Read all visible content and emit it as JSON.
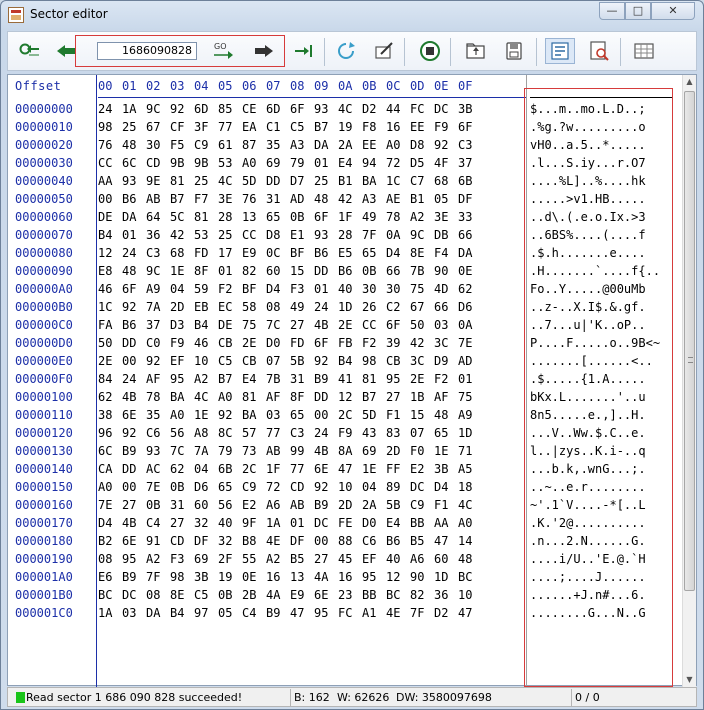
{
  "window": {
    "title": "Sector editor",
    "caption": {
      "minimize": "—",
      "maximize": "□",
      "close": "✕"
    }
  },
  "toolbar": {
    "sector_value": "1686090828",
    "go_label": "GO",
    "icons": [
      "first-sector-icon",
      "previous-sector-icon",
      "go-icon",
      "next-sector-icon",
      "last-sector-icon",
      "refresh-icon",
      "edit-icon",
      "stop-icon",
      "open-file-icon",
      "save-icon",
      "view-mode-icon",
      "search-icon",
      "settings-icon"
    ]
  },
  "editor": {
    "header_offset": "Offset",
    "columns": [
      "00",
      "01",
      "02",
      "03",
      "04",
      "05",
      "06",
      "07",
      "08",
      "09",
      "0A",
      "0B",
      "0C",
      "0D",
      "0E",
      "0F"
    ],
    "rows": [
      {
        "offset": "00000000",
        "bytes": [
          "24",
          "1A",
          "9C",
          "92",
          "6D",
          "85",
          "CE",
          "6D",
          "6F",
          "93",
          "4C",
          "D2",
          "44",
          "FC",
          "DC",
          "3B"
        ],
        "ascii": "$...m..mo.L.D..;"
      },
      {
        "offset": "00000010",
        "bytes": [
          "98",
          "25",
          "67",
          "CF",
          "3F",
          "77",
          "EA",
          "C1",
          "C5",
          "B7",
          "19",
          "F8",
          "16",
          "EE",
          "F9",
          "6F"
        ],
        "ascii": ".%g.?w.........o"
      },
      {
        "offset": "00000020",
        "bytes": [
          "76",
          "48",
          "30",
          "F5",
          "C9",
          "61",
          "87",
          "35",
          "A3",
          "DA",
          "2A",
          "EE",
          "A0",
          "D8",
          "92",
          "C3"
        ],
        "ascii": "vH0..a.5..*....."
      },
      {
        "offset": "00000030",
        "bytes": [
          "CC",
          "6C",
          "CD",
          "9B",
          "9B",
          "53",
          "A0",
          "69",
          "79",
          "01",
          "E4",
          "94",
          "72",
          "D5",
          "4F",
          "37"
        ],
        "ascii": ".l...S.iy...r.O7"
      },
      {
        "offset": "00000040",
        "bytes": [
          "AA",
          "93",
          "9E",
          "81",
          "25",
          "4C",
          "5D",
          "DD",
          "D7",
          "25",
          "B1",
          "BA",
          "1C",
          "C7",
          "68",
          "6B"
        ],
        "ascii": "....%L]..%....hk"
      },
      {
        "offset": "00000050",
        "bytes": [
          "00",
          "B6",
          "AB",
          "B7",
          "F7",
          "3E",
          "76",
          "31",
          "AD",
          "48",
          "42",
          "A3",
          "AE",
          "B1",
          "05",
          "DF"
        ],
        "ascii": ".....>v1.HB....."
      },
      {
        "offset": "00000060",
        "bytes": [
          "DE",
          "DA",
          "64",
          "5C",
          "81",
          "28",
          "13",
          "65",
          "0B",
          "6F",
          "1F",
          "49",
          "78",
          "A2",
          "3E",
          "33"
        ],
        "ascii": "..d\\.(.e.o.Ix.>3"
      },
      {
        "offset": "00000070",
        "bytes": [
          "B4",
          "01",
          "36",
          "42",
          "53",
          "25",
          "CC",
          "D8",
          "E1",
          "93",
          "28",
          "7F",
          "0A",
          "9C",
          "DB",
          "66"
        ],
        "ascii": "..6BS%....(....f"
      },
      {
        "offset": "00000080",
        "bytes": [
          "12",
          "24",
          "C3",
          "68",
          "FD",
          "17",
          "E9",
          "0C",
          "BF",
          "B6",
          "E5",
          "65",
          "D4",
          "8E",
          "F4",
          "DA"
        ],
        "ascii": ".$.h.......e...."
      },
      {
        "offset": "00000090",
        "bytes": [
          "E8",
          "48",
          "9C",
          "1E",
          "8F",
          "01",
          "82",
          "60",
          "15",
          "DD",
          "B6",
          "0B",
          "66",
          "7B",
          "90",
          "0E"
        ],
        "ascii": ".H.......`....f{.."
      },
      {
        "offset": "000000A0",
        "bytes": [
          "46",
          "6F",
          "A9",
          "04",
          "59",
          "F2",
          "BF",
          "D4",
          "F3",
          "01",
          "40",
          "30",
          "30",
          "75",
          "4D",
          "62"
        ],
        "ascii": "Fo..Y.....@00uMb"
      },
      {
        "offset": "000000B0",
        "bytes": [
          "1C",
          "92",
          "7A",
          "2D",
          "EB",
          "EC",
          "58",
          "08",
          "49",
          "24",
          "1D",
          "26",
          "C2",
          "67",
          "66",
          "D6"
        ],
        "ascii": "..z-..X.I$.&.gf."
      },
      {
        "offset": "000000C0",
        "bytes": [
          "FA",
          "B6",
          "37",
          "D3",
          "B4",
          "DE",
          "75",
          "7C",
          "27",
          "4B",
          "2E",
          "CC",
          "6F",
          "50",
          "03",
          "0A"
        ],
        "ascii": "..7...u|'K..oP.."
      },
      {
        "offset": "000000D0",
        "bytes": [
          "50",
          "DD",
          "C0",
          "F9",
          "46",
          "CB",
          "2E",
          "D0",
          "FD",
          "6F",
          "FB",
          "F2",
          "39",
          "42",
          "3C",
          "7E"
        ],
        "ascii": "P....F.....o..9B<~"
      },
      {
        "offset": "000000E0",
        "bytes": [
          "2E",
          "00",
          "92",
          "EF",
          "10",
          "C5",
          "CB",
          "07",
          "5B",
          "92",
          "B4",
          "98",
          "CB",
          "3C",
          "D9",
          "AD"
        ],
        "ascii": ".......[......<.."
      },
      {
        "offset": "000000F0",
        "bytes": [
          "84",
          "24",
          "AF",
          "95",
          "A2",
          "B7",
          "E4",
          "7B",
          "31",
          "B9",
          "41",
          "81",
          "95",
          "2E",
          "F2",
          "01"
        ],
        "ascii": ".$.....{1.A....."
      },
      {
        "offset": "00000100",
        "bytes": [
          "62",
          "4B",
          "78",
          "BA",
          "4C",
          "A0",
          "81",
          "AF",
          "8F",
          "DD",
          "12",
          "B7",
          "27",
          "1B",
          "AF",
          "75"
        ],
        "ascii": "bKx.L.......'..u"
      },
      {
        "offset": "00000110",
        "bytes": [
          "38",
          "6E",
          "35",
          "A0",
          "1E",
          "92",
          "BA",
          "03",
          "65",
          "00",
          "2C",
          "5D",
          "F1",
          "15",
          "48",
          "A9"
        ],
        "ascii": "8n5.....e.,]..H."
      },
      {
        "offset": "00000120",
        "bytes": [
          "96",
          "92",
          "C6",
          "56",
          "A8",
          "8C",
          "57",
          "77",
          "C3",
          "24",
          "F9",
          "43",
          "83",
          "07",
          "65",
          "1D"
        ],
        "ascii": "...V..Ww.$.C..e."
      },
      {
        "offset": "00000130",
        "bytes": [
          "6C",
          "B9",
          "93",
          "7C",
          "7A",
          "79",
          "73",
          "AB",
          "99",
          "4B",
          "8A",
          "69",
          "2D",
          "F0",
          "1E",
          "71"
        ],
        "ascii": "l..|zys..K.i-..q"
      },
      {
        "offset": "00000140",
        "bytes": [
          "CA",
          "DD",
          "AC",
          "62",
          "04",
          "6B",
          "2C",
          "1F",
          "77",
          "6E",
          "47",
          "1E",
          "FF",
          "E2",
          "3B",
          "A5"
        ],
        "ascii": "...b.k,.wnG...;."
      },
      {
        "offset": "00000150",
        "bytes": [
          "A0",
          "00",
          "7E",
          "0B",
          "D6",
          "65",
          "C9",
          "72",
          "CD",
          "92",
          "10",
          "04",
          "89",
          "DC",
          "D4",
          "18"
        ],
        "ascii": "..~..e.r........"
      },
      {
        "offset": "00000160",
        "bytes": [
          "7E",
          "27",
          "0B",
          "31",
          "60",
          "56",
          "E2",
          "A6",
          "AB",
          "B9",
          "2D",
          "2A",
          "5B",
          "C9",
          "F1",
          "4C"
        ],
        "ascii": "~'.1`V....-*[..L"
      },
      {
        "offset": "00000170",
        "bytes": [
          "D4",
          "4B",
          "C4",
          "27",
          "32",
          "40",
          "9F",
          "1A",
          "01",
          "DC",
          "FE",
          "D0",
          "E4",
          "BB",
          "AA",
          "A0"
        ],
        "ascii": ".K.'2@.........."
      },
      {
        "offset": "00000180",
        "bytes": [
          "B2",
          "6E",
          "91",
          "CD",
          "DF",
          "32",
          "B8",
          "4E",
          "DF",
          "00",
          "88",
          "C6",
          "B6",
          "B5",
          "47",
          "14"
        ],
        "ascii": ".n...2.N......G."
      },
      {
        "offset": "00000190",
        "bytes": [
          "08",
          "95",
          "A2",
          "F3",
          "69",
          "2F",
          "55",
          "A2",
          "B5",
          "27",
          "45",
          "EF",
          "40",
          "A6",
          "60",
          "48"
        ],
        "ascii": "....i/U..'E.@.`H"
      },
      {
        "offset": "000001A0",
        "bytes": [
          "E6",
          "B9",
          "7F",
          "98",
          "3B",
          "19",
          "0E",
          "16",
          "13",
          "4A",
          "16",
          "95",
          "12",
          "90",
          "1D",
          "BC"
        ],
        "ascii": "....;....J......"
      },
      {
        "offset": "000001B0",
        "bytes": [
          "BC",
          "DC",
          "08",
          "8E",
          "C5",
          "0B",
          "2B",
          "4A",
          "E9",
          "6E",
          "23",
          "BB",
          "BC",
          "82",
          "36",
          "10"
        ],
        "ascii": "......+J.n#...6."
      },
      {
        "offset": "000001C0",
        "bytes": [
          "1A",
          "03",
          "DA",
          "B4",
          "97",
          "05",
          "C4",
          "B9",
          "47",
          "95",
          "FC",
          "A1",
          "4E",
          "7F",
          "D2",
          "47"
        ],
        "ascii": "........G...N..G"
      }
    ]
  },
  "status": {
    "message": "Read sector 1 686 090 828 succeeded!",
    "byte": "B: 162",
    "word": "W: 62626",
    "dword": "DW: 3580097698",
    "position": "0 / 0"
  },
  "colors": {
    "offset_blue": "#1c2fa8",
    "highlight_red": "#d63b3b",
    "status_green": "#19c419"
  }
}
